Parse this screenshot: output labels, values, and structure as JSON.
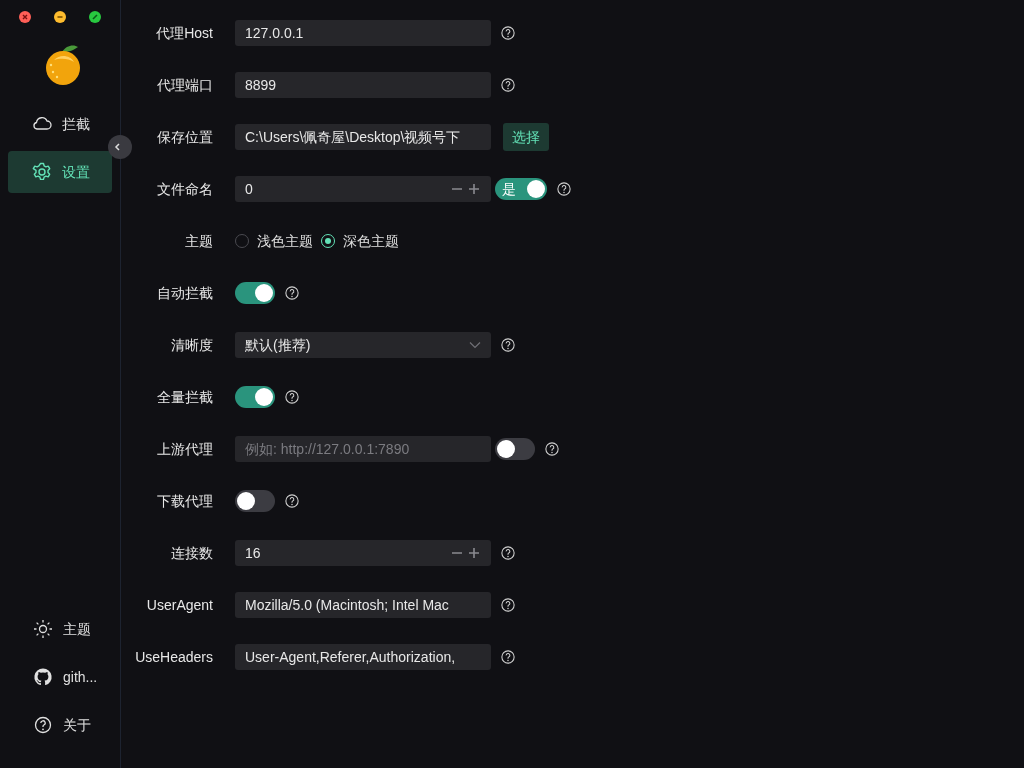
{
  "window_controls": [
    {
      "kind": "close"
    },
    {
      "kind": "minimize"
    },
    {
      "kind": "zoom"
    }
  ],
  "sidebar": {
    "items": [
      {
        "label": "拦截",
        "selected": false
      },
      {
        "label": "设置",
        "selected": true
      }
    ],
    "bottom_items": [
      {
        "label": "主题"
      },
      {
        "label": "gith..."
      },
      {
        "label": "关于"
      }
    ]
  },
  "settings": [
    {
      "kind": "input",
      "label": "代理Host",
      "value": "127.0.0.1",
      "help": true
    },
    {
      "kind": "input",
      "label": "代理端口",
      "value": "8899",
      "help": true
    },
    {
      "kind": "input",
      "label": "保存位置",
      "value": "C:\\Users\\佩奇屋\\Desktop\\视频号下",
      "button": "选择",
      "help": false
    },
    {
      "kind": "number",
      "label": "文件命名",
      "value": "0",
      "switch": {
        "on": true,
        "text": "是"
      },
      "help": true
    },
    {
      "kind": "radio",
      "label": "主题",
      "options": [
        {
          "label": "浅色主题",
          "selected": false
        },
        {
          "label": "深色主题",
          "selected": true
        }
      ],
      "help": false
    },
    {
      "kind": "switch",
      "label": "自动拦截",
      "on": true,
      "help": true
    },
    {
      "kind": "select",
      "label": "清晰度",
      "value": "默认(推荐)",
      "help": true
    },
    {
      "kind": "switch",
      "label": "全量拦截",
      "on": true,
      "help": true
    },
    {
      "kind": "input",
      "label": "上游代理",
      "placeholder": "例如: http://127.0.0.1:7890",
      "switch": {
        "on": false
      },
      "help": true
    },
    {
      "kind": "switch",
      "label": "下载代理",
      "on": false,
      "help": true
    },
    {
      "kind": "number",
      "label": "连接数",
      "value": "16",
      "help": true
    },
    {
      "kind": "input",
      "label": "UserAgent",
      "value": "Mozilla/5.0 (Macintosh; Intel Mac",
      "help": true
    },
    {
      "kind": "input",
      "label": "UseHeaders",
      "value": "User-Agent,Referer,Authorization,",
      "help": true
    }
  ]
}
